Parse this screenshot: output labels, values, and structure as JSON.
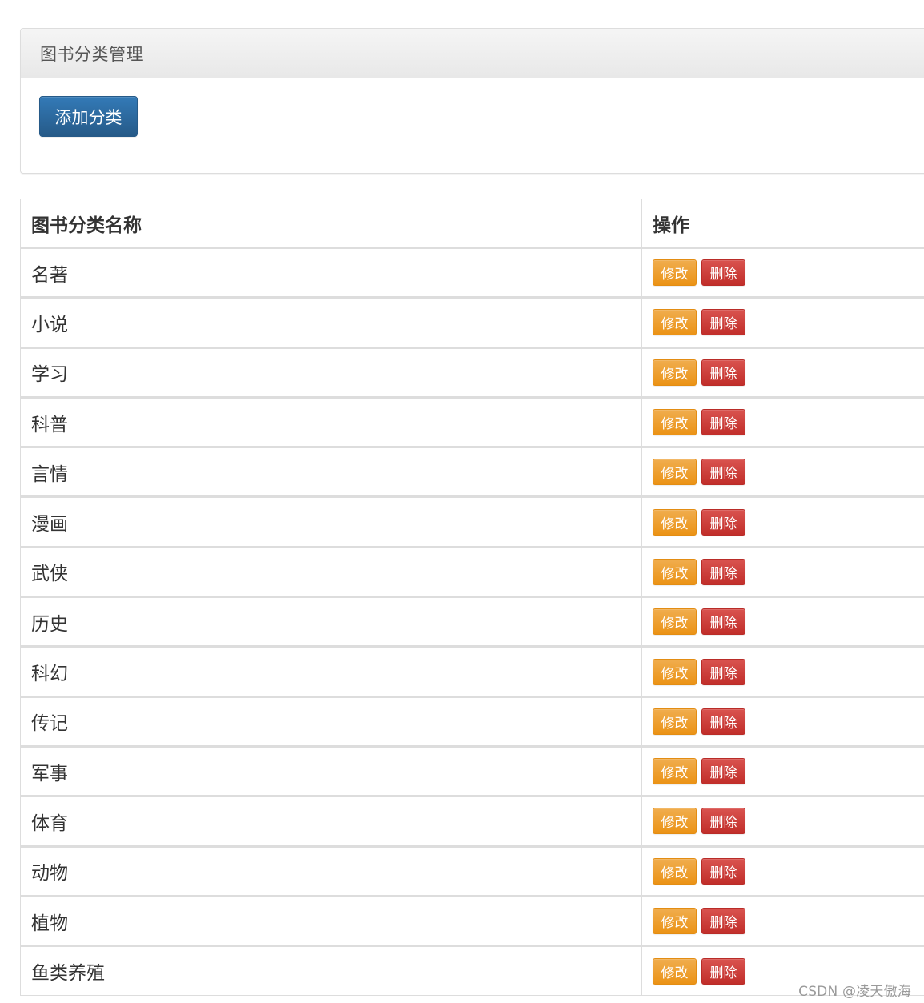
{
  "panel": {
    "title": "图书分类管理",
    "add_button_label": "添加分类"
  },
  "table": {
    "headers": [
      "图书分类名称",
      "操作"
    ],
    "edit_label": "修改",
    "delete_label": "删除",
    "rows": [
      "名著",
      "小说",
      "学习",
      "科普",
      "言情",
      "漫画",
      "武侠",
      "历史",
      "科幻",
      "传记",
      "军事",
      "体育",
      "动物",
      "植物",
      "鱼类养殖"
    ]
  },
  "watermark": "CSDN @凌天傲海",
  "colors": {
    "primary": "#337ab7",
    "warning": "#f0ad4e",
    "danger": "#d9534f",
    "border": "#dddddd"
  }
}
